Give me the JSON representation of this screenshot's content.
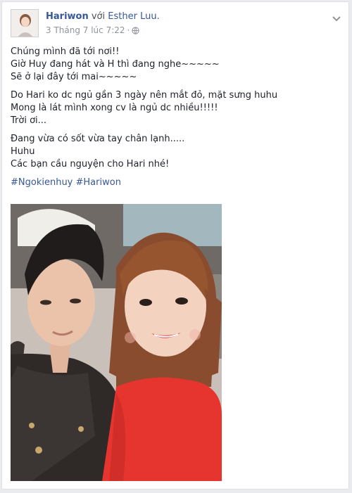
{
  "post": {
    "author": "Hariwon",
    "with_word": "với",
    "tagged": "Esther Luu.",
    "timestamp": "3 Tháng 7 lúc 7:22",
    "separator": "·",
    "privacy_icon": "globe-icon",
    "paragraphs": [
      [
        "Chúng mình đã tới nơi!!",
        "Giờ Huy đang hát và H thì đang nghe~~~~~",
        "Sẽ ở lại đây tới mai~~~~~"
      ],
      [
        "Do Hari ko dc ngủ gần 3 ngày nên mắt đỏ, mặt sưng huhu",
        "Mong là lát mình xong cv là ngủ dc nhiều!!!!!",
        "Trời ơi..."
      ],
      [
        "Đang vừa có sốt vừa tay chân lạnh.....",
        "Huhu",
        "Các bạn cầu nguyện cho Hari nhé!"
      ]
    ],
    "hashtags": [
      "#Ngokienhuy",
      "#Hariwon"
    ]
  },
  "colors": {
    "link": "#365899",
    "text": "#1d2129",
    "meta": "#90949c",
    "dress": "#e8332f"
  }
}
